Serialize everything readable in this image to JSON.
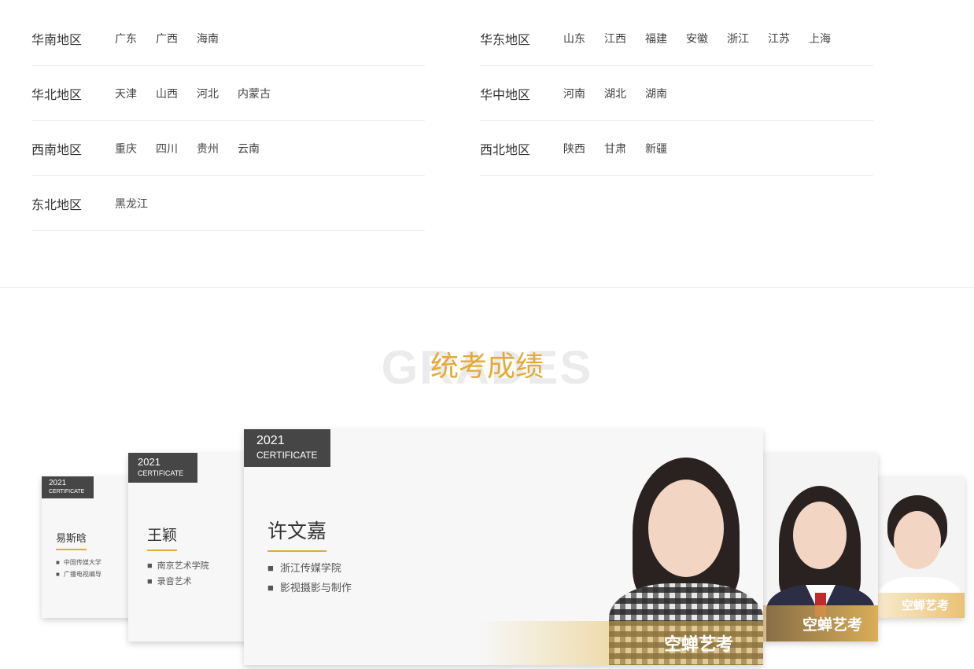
{
  "regions": {
    "left": [
      {
        "name": "华南地区",
        "provinces": [
          "广东",
          "广西",
          "海南"
        ]
      },
      {
        "name": "华北地区",
        "provinces": [
          "天津",
          "山西",
          "河北",
          "内蒙古"
        ]
      },
      {
        "name": "西南地区",
        "provinces": [
          "重庆",
          "四川",
          "贵州",
          "云南"
        ]
      },
      {
        "name": "东北地区",
        "provinces": [
          "黑龙江"
        ]
      }
    ],
    "right": [
      {
        "name": "华东地区",
        "provinces": [
          "山东",
          "江西",
          "福建",
          "安徽",
          "浙江",
          "江苏",
          "上海"
        ]
      },
      {
        "name": "华中地区",
        "provinces": [
          "河南",
          "湖北",
          "湖南"
        ]
      },
      {
        "name": "西北地区",
        "provinces": [
          "陕西",
          "甘肃",
          "新疆"
        ]
      }
    ]
  },
  "grades": {
    "bg_text": "GRADES",
    "title": "统考成绩"
  },
  "cards": [
    {
      "year": "2021",
      "cert": "CERTIFICATE",
      "name": "易斯晗",
      "info": [
        "中国传媒大学",
        "广播电视编导"
      ]
    },
    {
      "year": "2021",
      "cert": "CERTIFICATE",
      "name": "王颖",
      "info": [
        "南京艺术学院",
        "录音艺术"
      ]
    },
    {
      "year": "2021",
      "cert": "CERTIFICATE",
      "name": "许文嘉",
      "info": [
        "浙江传媒学院",
        "影视摄影与制作"
      ]
    }
  ],
  "brand_text": "空蝉艺考",
  "colors": {
    "accent": "#e2aa36",
    "tag_bg": "#464646"
  }
}
